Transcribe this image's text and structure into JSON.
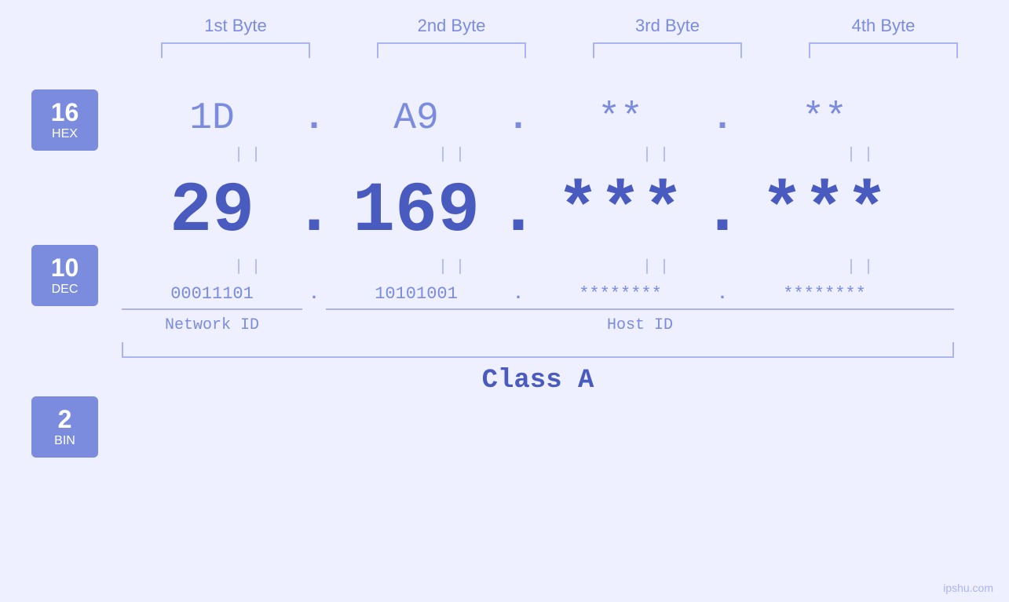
{
  "header": {
    "byte1_label": "1st Byte",
    "byte2_label": "2nd Byte",
    "byte3_label": "3rd Byte",
    "byte4_label": "4th Byte"
  },
  "badges": {
    "hex": {
      "num": "16",
      "label": "HEX"
    },
    "dec": {
      "num": "10",
      "label": "DEC"
    },
    "bin": {
      "num": "2",
      "label": "BIN"
    }
  },
  "hex_row": {
    "byte1": "1D",
    "byte2": "A9",
    "byte3": "**",
    "byte4": "**",
    "dots": [
      ".",
      ".",
      "."
    ]
  },
  "dec_row": {
    "byte1": "29",
    "byte2": "169",
    "byte3": "***",
    "byte4": "***",
    "dots": [
      ".",
      ".",
      "."
    ]
  },
  "bin_row": {
    "byte1": "00011101",
    "byte2": "10101001",
    "byte3": "********",
    "byte4": "********",
    "dots": [
      ".",
      ".",
      "."
    ]
  },
  "labels": {
    "network_id": "Network ID",
    "host_id": "Host ID",
    "class": "Class A"
  },
  "watermark": "ipshu.com"
}
